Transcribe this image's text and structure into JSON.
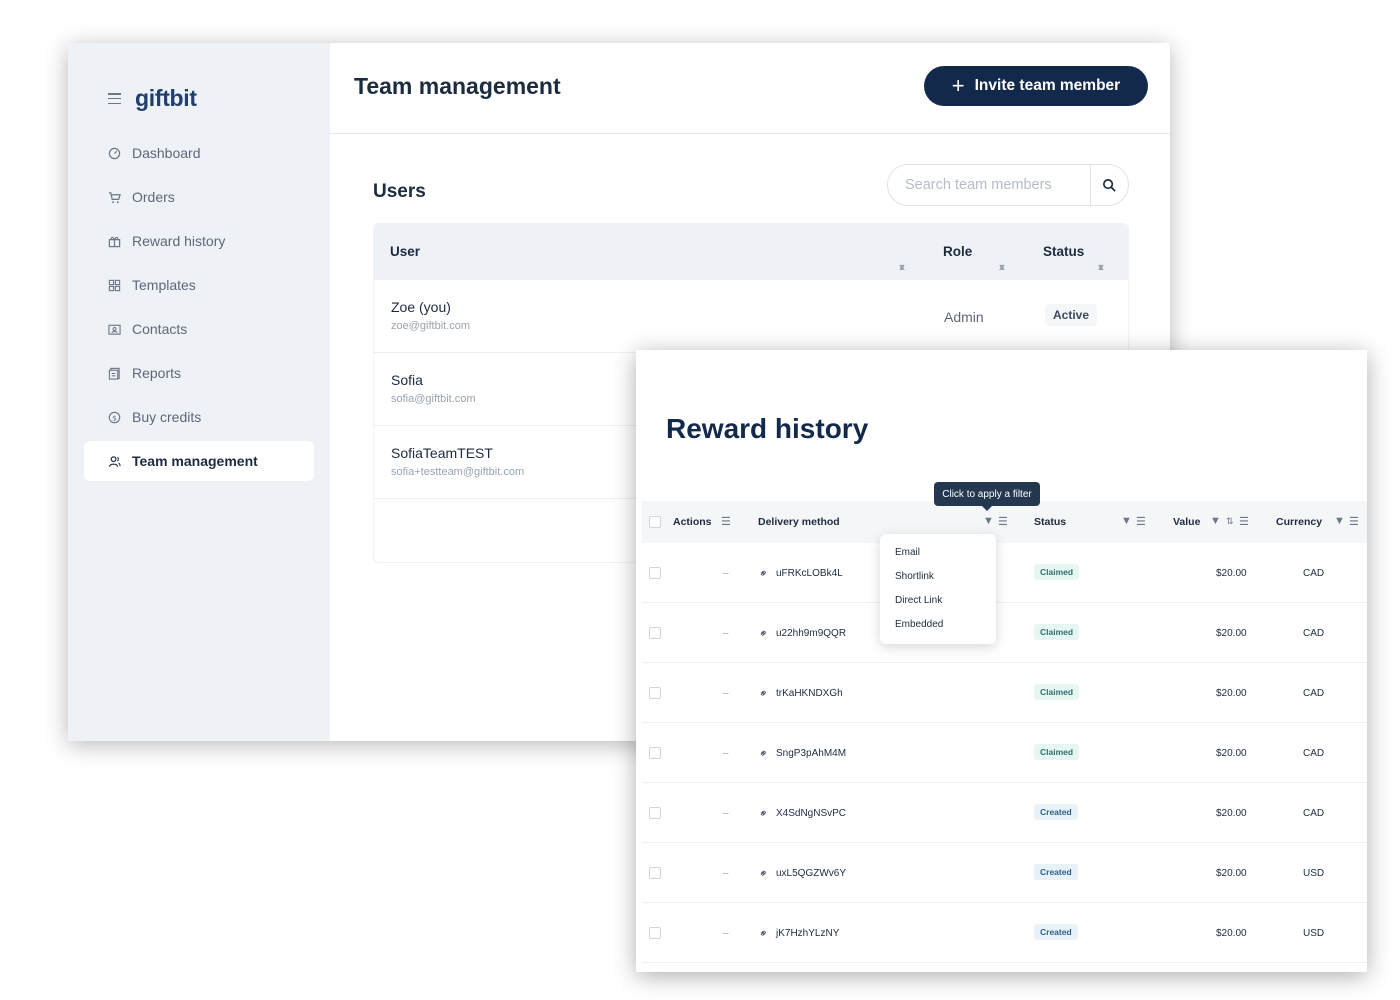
{
  "team_window": {
    "logo": "giftbit",
    "nav": [
      {
        "label": "Dashboard",
        "icon": "dashboard-icon"
      },
      {
        "label": "Orders",
        "icon": "cart-icon"
      },
      {
        "label": "Reward history",
        "icon": "gift-icon"
      },
      {
        "label": "Templates",
        "icon": "grid-icon"
      },
      {
        "label": "Contacts",
        "icon": "contact-card-icon"
      },
      {
        "label": "Reports",
        "icon": "report-icon"
      },
      {
        "label": "Buy credits",
        "icon": "dollar-icon"
      },
      {
        "label": "Team management",
        "icon": "team-icon",
        "active": true
      }
    ],
    "page_title": "Team management",
    "invite_button": "Invite team member",
    "users_title": "Users",
    "search_placeholder": "Search team members",
    "table": {
      "columns": [
        "User",
        "Role",
        "Status"
      ],
      "rows": [
        {
          "name": "Zoe (you)",
          "email": "zoe@giftbit.com",
          "role": "Admin",
          "status": "Active"
        },
        {
          "name": "Sofia",
          "email": "sofia@giftbit.com",
          "role": "",
          "status": ""
        },
        {
          "name": "SofiaTeamTEST",
          "email": "sofia+testteam@giftbit.com",
          "role": "",
          "status": ""
        }
      ]
    }
  },
  "reward_window": {
    "title": "Reward history",
    "tooltip": "Click to apply a filter",
    "columns": [
      "Actions",
      "Delivery method",
      "Status",
      "Value",
      "Currency"
    ],
    "filter_options": [
      "Email",
      "Shortlink",
      "Direct Link",
      "Embedded"
    ],
    "rows": [
      {
        "action": "–",
        "delivery": "uFRKcLOBk4L",
        "status": "Claimed",
        "value": "$20.00",
        "currency": "CAD"
      },
      {
        "action": "–",
        "delivery": "u22hh9m9QQR",
        "status": "Claimed",
        "value": "$20.00",
        "currency": "CAD"
      },
      {
        "action": "–",
        "delivery": "trKaHKNDXGh",
        "status": "Claimed",
        "value": "$20.00",
        "currency": "CAD"
      },
      {
        "action": "–",
        "delivery": "SngP3pAhM4M",
        "status": "Claimed",
        "value": "$20.00",
        "currency": "CAD"
      },
      {
        "action": "–",
        "delivery": "X4SdNgNSvPC",
        "status": "Created",
        "value": "$20.00",
        "currency": "CAD"
      },
      {
        "action": "–",
        "delivery": "uxL5QGZWv6Y",
        "status": "Created",
        "value": "$20.00",
        "currency": "USD"
      },
      {
        "action": "–",
        "delivery": "jK7HzhYLzNY",
        "status": "Created",
        "value": "$20.00",
        "currency": "USD"
      }
    ]
  },
  "colors": {
    "brand_navy": "#13294b",
    "sidebar_bg": "#eef1f5",
    "claimed_badge": "#e6f6f2",
    "created_badge": "#e8f2f9"
  }
}
